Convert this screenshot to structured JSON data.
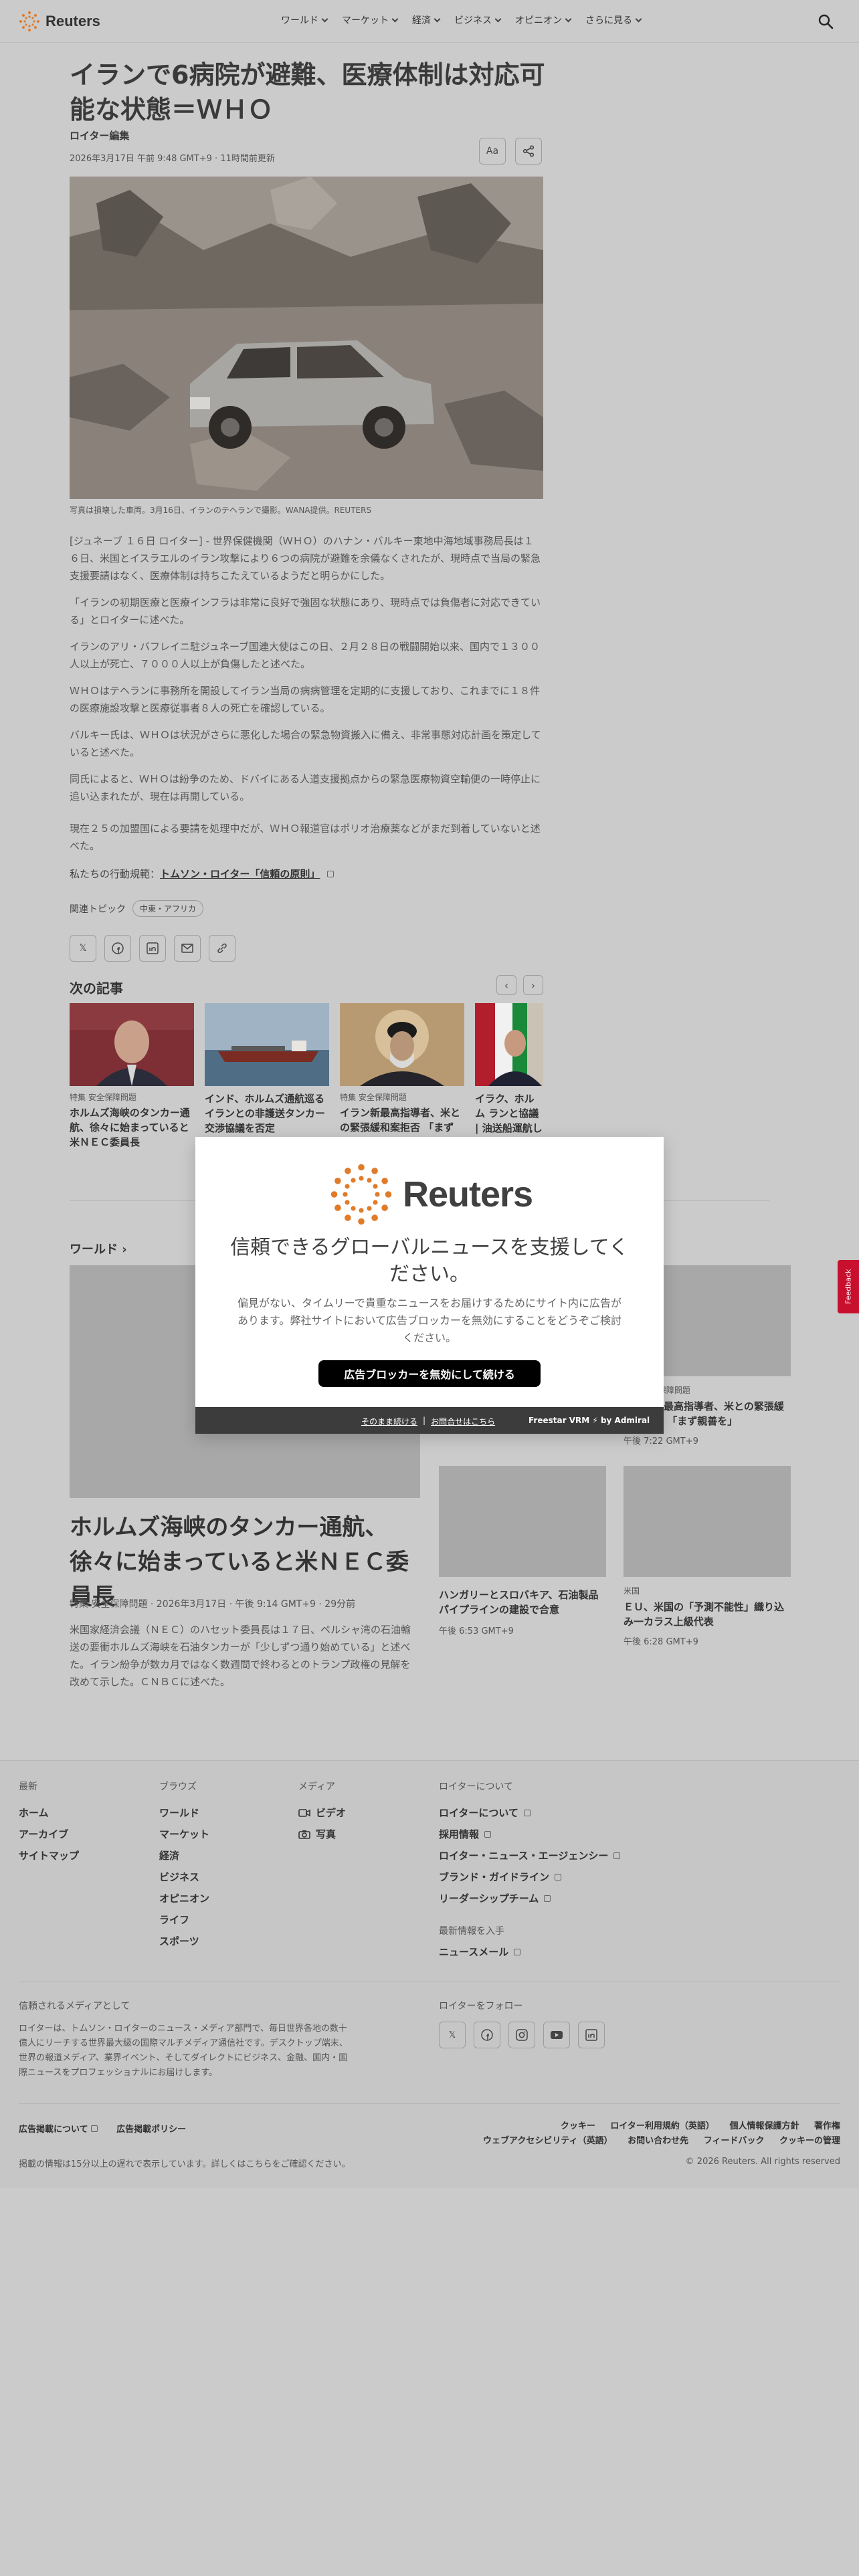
{
  "header": {
    "logo_text": "Reuters",
    "nav": [
      "ワールド",
      "マーケット",
      "経済",
      "ビジネス",
      "オピニオン",
      "さらに見る"
    ]
  },
  "article": {
    "title": "イランで6病院が避難、医療体制は対応可能な状態＝ＷＨＯ",
    "byline": "ロイター編集",
    "date": "2026年3月17日 午前 9:48 GMT+9 · 11時間前更新",
    "text_size_label": "Aa",
    "caption": "写真は損壊した車両。3月16日、イランのテヘランで撮影。WANA提供。REUTERS",
    "paragraphs": [
      "[ジュネーブ １６日 ロイター] - 世界保健機関（ＷＨＯ）のハナン・バルキー東地中海地域事務局長は１６日、米国とイスラエルのイラン攻撃により６つの病院が避難を余儀なくされたが、現時点で当局の緊急支援要請はなく、医療体制は持ちこたえているようだと明らかにした。",
      "「イランの初期医療と医療インフラは非常に良好で強固な状態にあり、現時点では負傷者に対応できている」とロイターに述べた。",
      "イランのアリ・バフレイニ駐ジュネーブ国連大使はこの日、２月２８日の戦闘開始以来、国内で１３００人以上が死亡、７０００人以上が負傷したと述べた。",
      "ＷＨＯはテヘランに事務所を開設してイラン当局の病病管理を定期的に支援しており、これまでに１８件の医療施設攻撃と医療従事者８人の死亡を確認している。",
      "バルキー氏は、ＷＨＯは状況がさらに悪化した場合の緊急物資搬入に備え、非常事態対応計画を策定していると述べた。",
      "同氏によると、ＷＨＯは紛争のため、ドバイにある人道支援拠点からの緊急医療物資空輸便の一時停止に追い込まれたが、現在は再開している。",
      "現在２５の加盟国による要請を処理中だが、ＷＨＯ報道官はポリオ治療薬などがまだ到着していないと述べた。"
    ],
    "principles_prefix": "私たちの行動規範：",
    "principles_link": "トムソン・ロイター「信頼の原則」",
    "topics_label": "関連トピック",
    "topic_chip": "中東・アフリカ"
  },
  "next_articles": {
    "heading": "次の記事",
    "items": [
      {
        "kicker": "特集 安全保障問題",
        "headline": "ホルムズ海峡のタンカー通航、徐々に始まっていると米ＮＥＣ委員長"
      },
      {
        "kicker": "",
        "headline": "インド、ホルムズ通航巡るイランとの非護送タンカー交渉協議を否定"
      },
      {
        "kicker": "特集 安全保障問題",
        "headline": "イラン新最高指導者、米との緊張緩和案拒否 「まず"
      },
      {
        "kicker": "",
        "headline": "イラク、ホルム ランと協議 | 油送船運航し"
      }
    ]
  },
  "world": {
    "heading": "ワールド",
    "lead": {
      "title": "ホルムズ海峡のタンカー通航、徐々に始まっていると米ＮＥＣ委員長",
      "meta": "特集 安全保障問題 · 2026年3月17日 · 午後 9:14 GMT+9 · 29分前",
      "desc": "米国家経済会議（ＮＥＣ）のハセット委員長は１７日、ペルシャ湾の石油輸送の要衝ホルムズ海峡を石油タンカーが「少しずつ通り始めている」と述べた。イラン紛争が数カ月ではなく数週間で終わるとのトランプ政権の見解を改めて示した。ＣＮＢＣに述べた。"
    },
    "grid": [
      {
        "kicker": "特集 安全保障問題",
        "headline": "イラン新最高指導者、米との緊張緩和案拒否 「まず親善を」",
        "time": "午後 7:22 GMT+9"
      },
      {
        "kicker": "",
        "headline": "ハンガリーとスロバキア、石油製品パイプラインの建設で合意",
        "time": "午後 6:53 GMT+9"
      },
      {
        "kicker": "米国",
        "headline": "ＥＵ、米国の「予測不能性」織り込み一カラス上級代表",
        "time": "午後 6:28 GMT+9"
      }
    ]
  },
  "feedback_label": "Feedback",
  "footer": {
    "columns": [
      {
        "heading": "最新",
        "items": [
          "ホーム",
          "アーカイブ",
          "サイトマップ"
        ]
      },
      {
        "heading": "ブラウズ",
        "items": [
          "ワールド",
          "マーケット",
          "経済",
          "ビジネス",
          "オピニオン",
          "ライフ",
          "スポーツ"
        ]
      },
      {
        "heading": "メディア",
        "items": [
          "ビデオ",
          "写真"
        ]
      },
      {
        "heading": "ロイターについて",
        "items": [
          "ロイターについて",
          "採用情報",
          "ロイター・ニュース・エージェンシー",
          "ブランド・ガイドライン",
          "リーダーシップチーム"
        ]
      }
    ],
    "latest_info_heading": "最新情報を入手",
    "latest_info_item": "ニュースメール",
    "trusted_heading": "信頼されるメディアとして",
    "trusted_text": "ロイターは、トムソン・ロイターのニュース・メディア部門で、毎日世界各地の数十億人にリーチする世界最大級の国際マルチメディア通信社です。デスクトップ端末、世界の報道メディア、業界イベント、そしてダイレクトにビジネス、金融、国内・国際ニュースをプロフェッショナルにお届けします。",
    "follow_heading": "ロイターをフォロー",
    "bottom_left": [
      "広告掲載について",
      "広告掲載ポリシー"
    ],
    "bottom_right": [
      "クッキー",
      "ロイター利用規約（英語）",
      "個人情報保護方針",
      "著作権",
      "ウェブアクセシビリティ（英語）",
      "お問い合わせ先",
      "フィードバック",
      "クッキーの管理"
    ],
    "delay_note": "掲載の情報は15分以上の遅れで表示しています。詳しくはこちらをご確認ください。",
    "copyright": "© 2026 Reuters. All rights reserved"
  },
  "modal": {
    "logo_text": "Reuters",
    "heading": "信頼できるグローバルニュースを支援してください。",
    "text": "偏見がない、タイムリーで貴重なニュースをお届けするためにサイト内に広告があります。弊社サイトにおいて広告ブロッカーを無効にすることをどうぞご検討ください。",
    "button": "広告ブロッカーを無効にして続ける",
    "link_continue": "そのまま続ける",
    "link_contact": "お問合せはこちら",
    "brand": "Freestar VRM ⚡ by Admiral"
  }
}
